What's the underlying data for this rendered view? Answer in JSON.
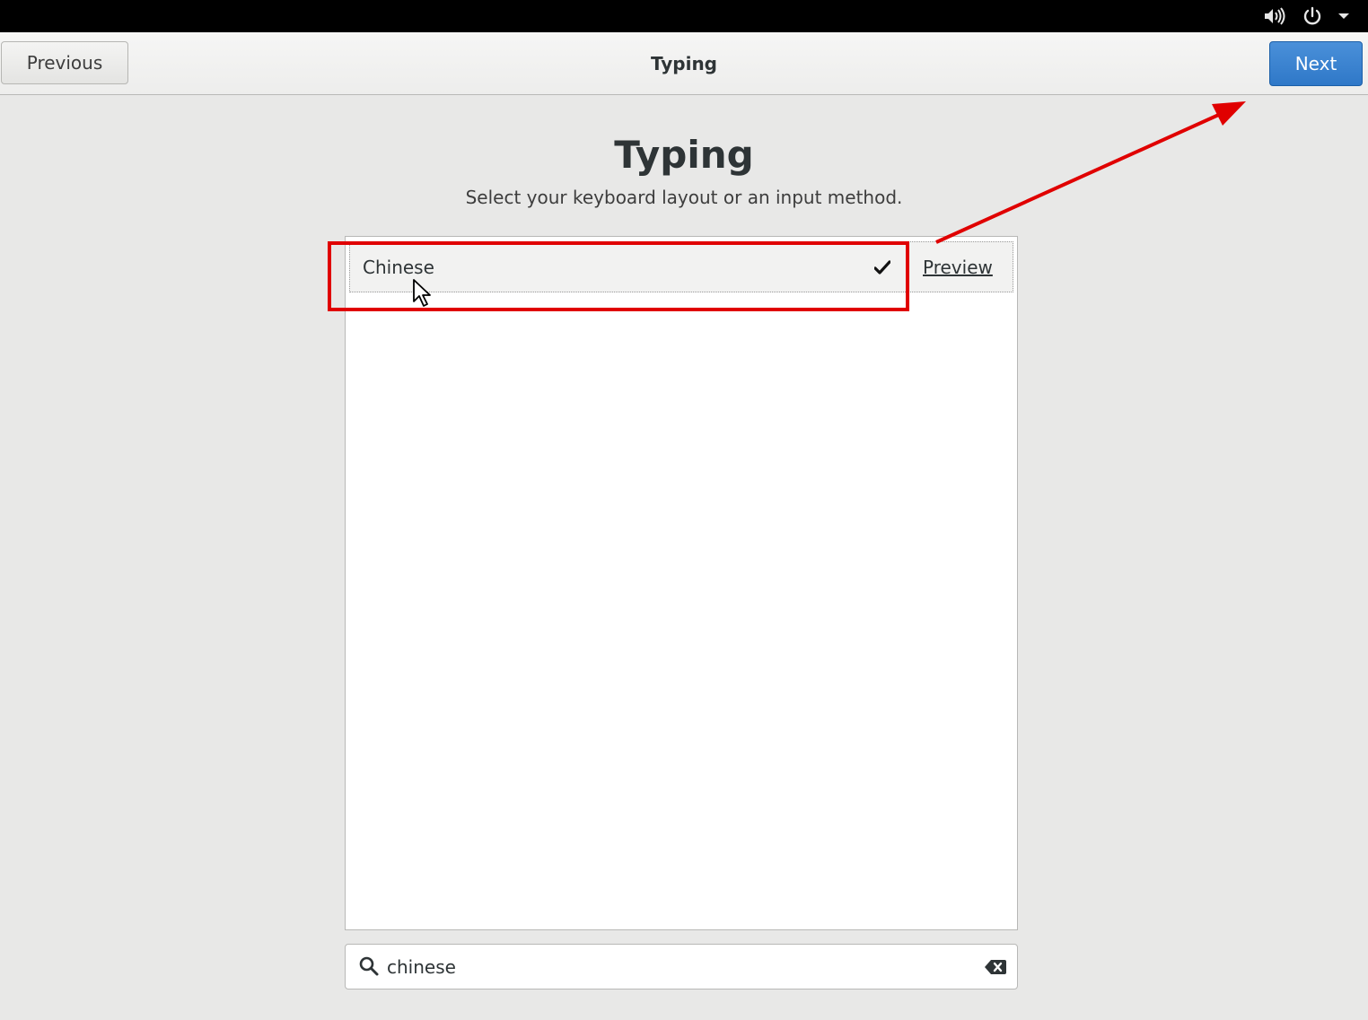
{
  "system_tray": {
    "icons": [
      "volume-icon",
      "power-icon",
      "menu-arrow-icon"
    ]
  },
  "header": {
    "previous_label": "Previous",
    "title": "Typing",
    "next_label": "Next"
  },
  "main": {
    "title": "Typing",
    "subtitle": "Select your keyboard layout or an input method."
  },
  "layouts": {
    "items": [
      {
        "label": "Chinese",
        "selected": true,
        "preview_label": "Preview"
      }
    ]
  },
  "search": {
    "value": "chinese"
  },
  "annotation": {
    "color": "#e00000"
  },
  "colors": {
    "accent": "#3584e4",
    "topbar": "#000000",
    "background": "#e8e8e7"
  }
}
